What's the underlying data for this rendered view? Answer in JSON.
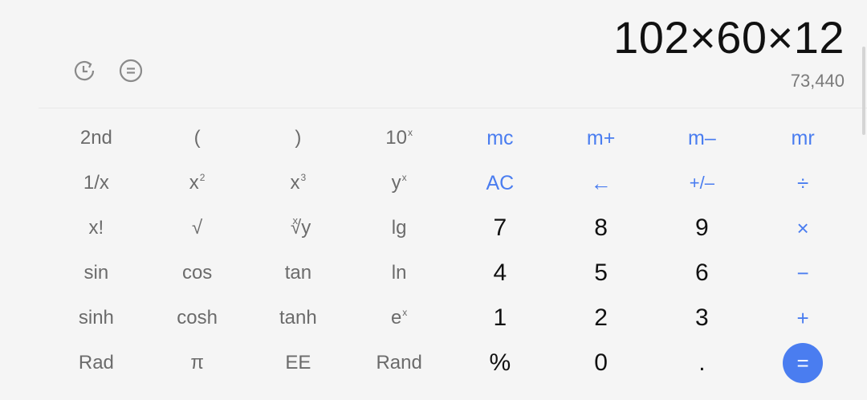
{
  "display": {
    "expression": "102×60×12",
    "result": "73,440",
    "history_icon": "history-clock-icon",
    "mode_icon": "equals-circle-icon"
  },
  "keys": {
    "r1": [
      "2nd",
      "(",
      ")",
      "10",
      "mc",
      "m+",
      "m–",
      "mr"
    ],
    "r1_sup": {
      "10": "x"
    },
    "r2": [
      "1/x",
      "x",
      "x",
      "y",
      "AC",
      "←",
      "+/–",
      "÷"
    ],
    "r2_sup": [
      "2",
      "3",
      "x"
    ],
    "r3": [
      "x!",
      "√",
      "y",
      "lg",
      "7",
      "8",
      "9",
      "×"
    ],
    "r3_root_index": "x",
    "r4": [
      "sin",
      "cos",
      "tan",
      "ln",
      "4",
      "5",
      "6",
      "−"
    ],
    "r5": [
      "sinh",
      "cosh",
      "tanh",
      "e",
      "1",
      "2",
      "3",
      "+"
    ],
    "r5_sup": "x",
    "r6": [
      "Rad",
      "π",
      "EE",
      "Rand",
      "%",
      "0",
      ".",
      "="
    ]
  },
  "colors": {
    "accent": "#4a7df0",
    "background": "#f5f5f5",
    "function_text": "#6b6b6b",
    "digit_text": "#111111"
  }
}
